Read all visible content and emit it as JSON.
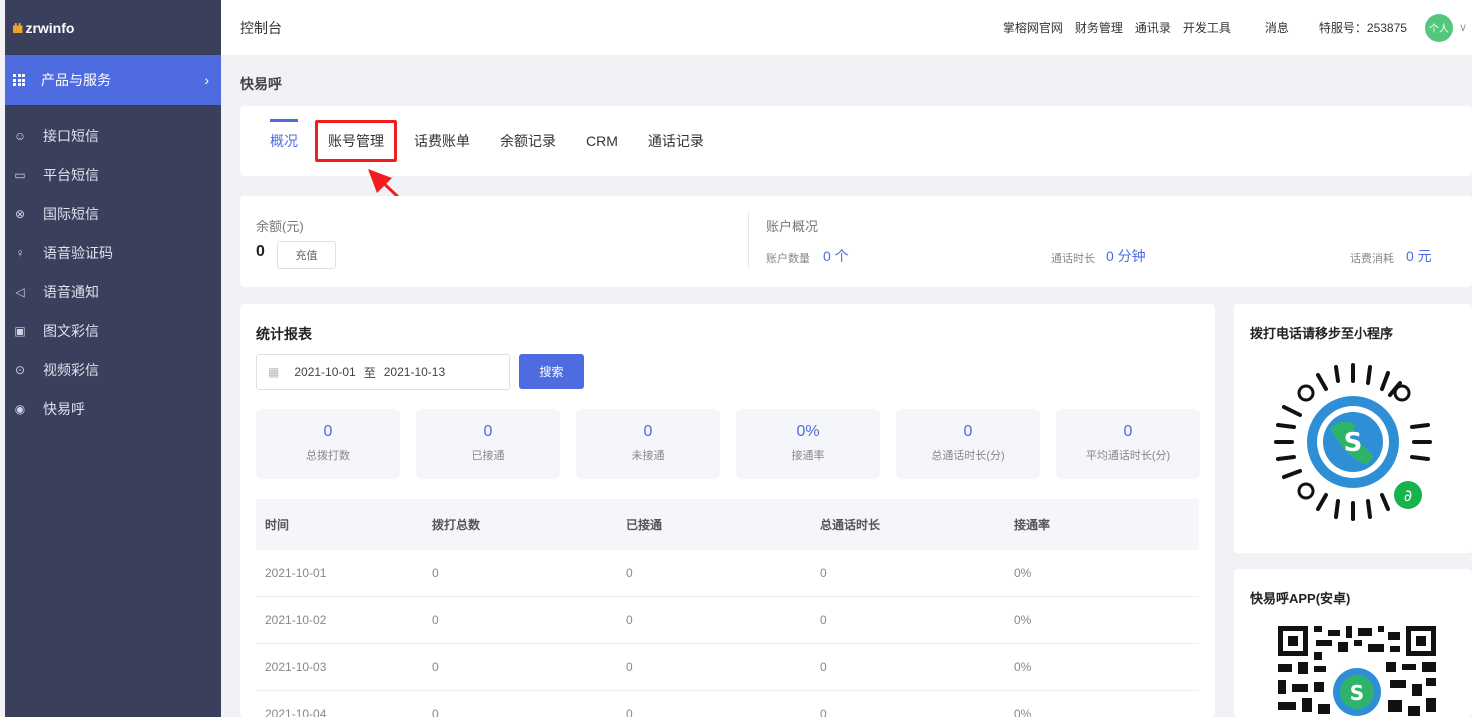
{
  "sidebar": {
    "logo": "zrwinfo",
    "logo_mark": "ılılı",
    "section_title": "产品与服务",
    "items": [
      {
        "label": "接口短信",
        "icon": "chat-icon"
      },
      {
        "label": "平台短信",
        "icon": "message-icon"
      },
      {
        "label": "国际短信",
        "icon": "globe-icon"
      },
      {
        "label": "语音验证码",
        "icon": "microphone-icon"
      },
      {
        "label": "语音通知",
        "icon": "speaker-icon"
      },
      {
        "label": "图文彩信",
        "icon": "image-icon"
      },
      {
        "label": "视频彩信",
        "icon": "video-icon"
      },
      {
        "label": "快易呼",
        "icon": "call-icon"
      }
    ]
  },
  "topbar": {
    "title": "控制台",
    "links": [
      "掌榕网官网",
      "财务管理",
      "通讯录",
      "开发工具"
    ],
    "messages": "消息",
    "account_no": "特服号：253875",
    "avatar_label": "个人"
  },
  "page_heading": "快易呼",
  "tabs": [
    {
      "label": "概况",
      "active": true
    },
    {
      "label": "账号管理",
      "highlight": true
    },
    {
      "label": "话费账单"
    },
    {
      "label": "余额记录"
    },
    {
      "label": "CRM"
    },
    {
      "label": "通话记录"
    }
  ],
  "balance": {
    "label": "余额(元)",
    "value": "0",
    "recharge": "充值"
  },
  "account_overview": {
    "label": "账户概况",
    "count_label": "账户数量",
    "count_value": "0 个",
    "duration_label": "通话时长",
    "duration_value": "0 分钟",
    "cost_label": "话费消耗",
    "cost_value": "0 元"
  },
  "report": {
    "title": "统计报表",
    "date_from": "2021-10-01",
    "date_sep": "至",
    "date_to": "2021-10-13",
    "search": "搜索",
    "kpis": [
      {
        "value": "0",
        "label": "总拨打数"
      },
      {
        "value": "0",
        "label": "已接通"
      },
      {
        "value": "0",
        "label": "未接通"
      },
      {
        "value": "0%",
        "label": "接通率"
      },
      {
        "value": "0",
        "label": "总通话时长(分)"
      },
      {
        "value": "0",
        "label": "平均通话时长(分)"
      }
    ],
    "columns": [
      "时间",
      "拨打总数",
      "已接通",
      "总通话时长",
      "接通率"
    ],
    "rows": [
      [
        "2021-10-01",
        "0",
        "0",
        "0",
        "0%"
      ],
      [
        "2021-10-02",
        "0",
        "0",
        "0",
        "0%"
      ],
      [
        "2021-10-03",
        "0",
        "0",
        "0",
        "0%"
      ],
      [
        "2021-10-04",
        "0",
        "0",
        "0",
        "0%"
      ]
    ]
  },
  "miniprogram": {
    "title": "拨打电话请移步至小程序"
  },
  "app": {
    "title": "快易呼APP(安卓)"
  },
  "colors": {
    "accent": "#4f6be0",
    "sidebar": "#3a3f5c",
    "highlight": "#f01e1e"
  }
}
